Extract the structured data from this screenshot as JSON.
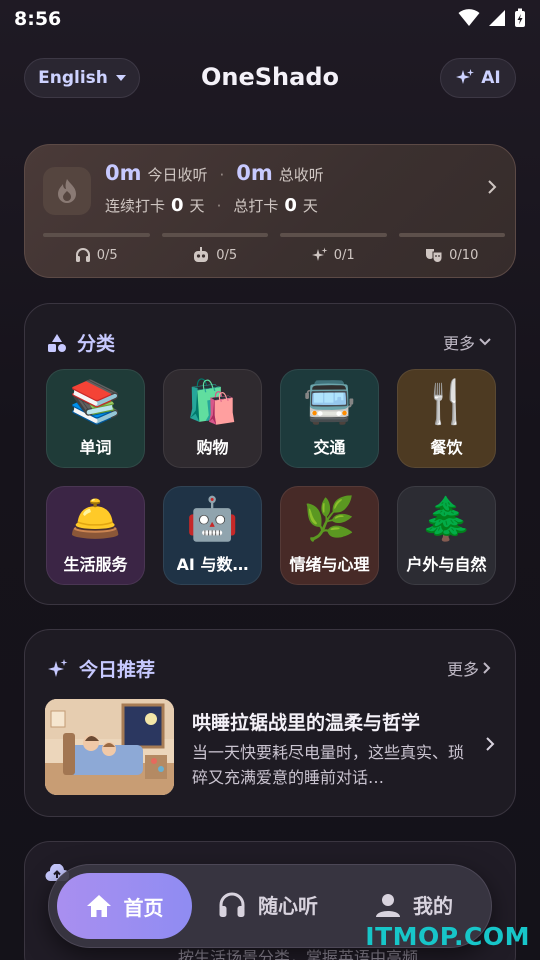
{
  "status_bar": {
    "time": "8:56"
  },
  "header": {
    "language": "English",
    "title": "OneShado",
    "ai_label": "AI"
  },
  "stats": {
    "today_value": "0m",
    "today_label": "今日收听",
    "total_value": "0m",
    "total_label": "总收听",
    "streak_label": "连续打卡",
    "streak_value": "0",
    "streak_unit": "天",
    "checkin_label": "总打卡",
    "checkin_value": "0",
    "checkin_unit": "天",
    "progress": [
      {
        "icon": "headphones-icon",
        "text": "0/5",
        "fraction": 0
      },
      {
        "icon": "robot-icon",
        "text": "0/5",
        "fraction": 0
      },
      {
        "icon": "sparkle-icon",
        "text": "0/1",
        "fraction": 0
      },
      {
        "icon": "theater-mask-icon",
        "text": "0/10",
        "fraction": 0
      }
    ]
  },
  "categories": {
    "title": "分类",
    "more": "更多",
    "items": [
      {
        "label": "单词",
        "emoji": "📚",
        "color": "#1f3b38"
      },
      {
        "label": "购物",
        "emoji": "🛍️",
        "color": "#2f2a2f"
      },
      {
        "label": "交通",
        "emoji": "🚍",
        "color": "#1d3a3c"
      },
      {
        "label": "餐饮",
        "emoji": "🍴",
        "color": "#4d3a22"
      },
      {
        "label": "生活服务",
        "emoji": "🛎️",
        "color": "#3b2545"
      },
      {
        "label": "AI 与数…",
        "emoji": "🤖",
        "color": "#1f3346"
      },
      {
        "label": "情绪与心理",
        "emoji": "🌿",
        "color": "#472a27"
      },
      {
        "label": "户外与自然",
        "emoji": "🌲",
        "color": "#2c2c33"
      }
    ]
  },
  "recommend": {
    "title": "今日推荐",
    "more": "更多",
    "item_title": "哄睡拉锯战里的温柔与哲学",
    "item_desc": "当一天快要耗尽电量时，这些真实、琐碎又充满爱意的睡前对话…"
  },
  "bottom_card": {
    "desc": "按生活场景分类，掌握英语中高频"
  },
  "nav": {
    "home": "首页",
    "listen": "随心听",
    "mine": "我的"
  },
  "watermark": "ITMOP.COM"
}
